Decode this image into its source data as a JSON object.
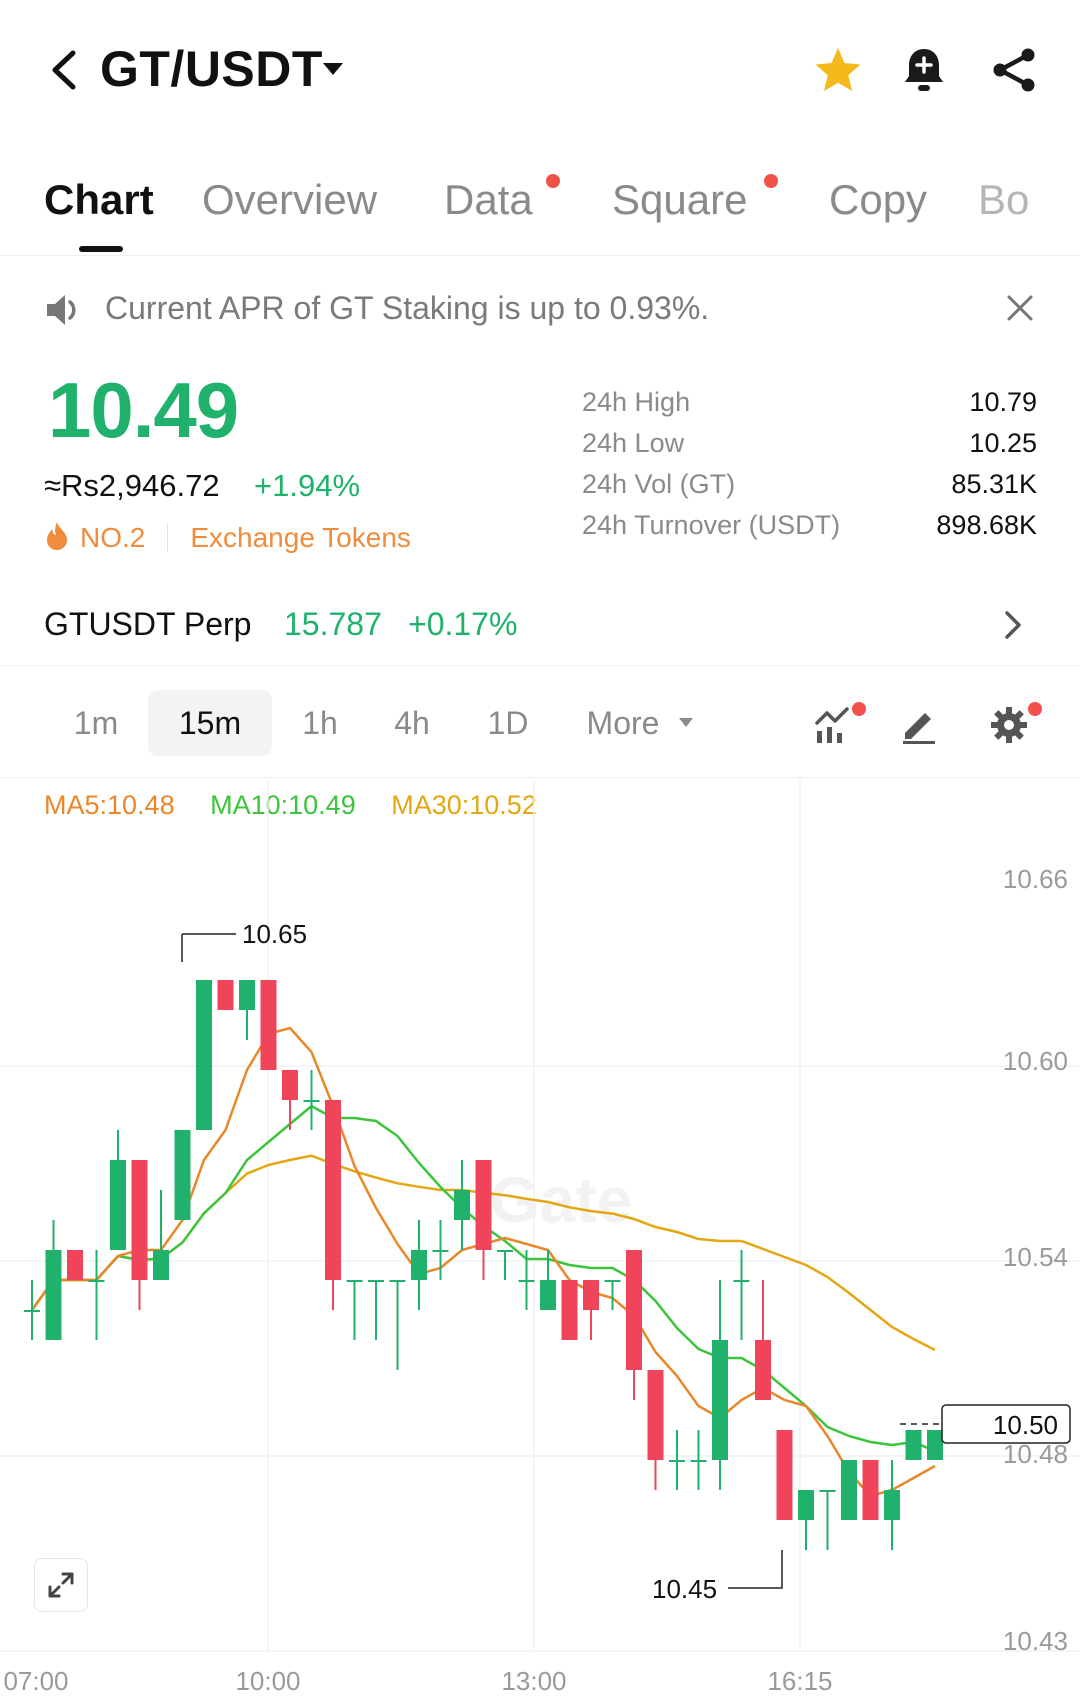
{
  "header": {
    "pair": "GT/USDT",
    "icons": [
      "back-icon",
      "caret-down-icon",
      "star-icon",
      "bell-plus-icon",
      "share-icon"
    ],
    "star_color": "#f5b91b"
  },
  "tabs": [
    {
      "label": "Chart",
      "active": true
    },
    {
      "label": "Overview",
      "active": false
    },
    {
      "label": "Data",
      "active": false,
      "dot": true
    },
    {
      "label": "Square",
      "active": false,
      "dot": true
    },
    {
      "label": "Copy",
      "active": false
    },
    {
      "label": "Bo",
      "active": false
    }
  ],
  "notice": {
    "text": "Current APR of GT Staking is up to 0.93%.",
    "icons": [
      "speaker-icon",
      "close-icon"
    ]
  },
  "price": {
    "last": "10.49",
    "fiat": "≈Rs2,946.72",
    "change": "+1.94%",
    "rank": "NO.2",
    "category": "Exchange Tokens",
    "up_color": "#20b26c",
    "down_color": "#f0445a",
    "rank_color": "#f08c3a"
  },
  "stats": [
    {
      "label": "24h High",
      "value": "10.79"
    },
    {
      "label": "24h Low",
      "value": "10.25"
    },
    {
      "label": "24h Vol (GT)",
      "value": "85.31K"
    },
    {
      "label": "24h Turnover (USDT)",
      "value": "898.68K"
    }
  ],
  "perp": {
    "name": "GTUSDT Perp",
    "price": "15.787",
    "change": "+0.17%"
  },
  "intervals": {
    "items": [
      "1m",
      "15m",
      "1h",
      "4h",
      "1D"
    ],
    "active": "15m",
    "more": "More",
    "tool_icons": [
      "indicator-icon",
      "draw-pencil-icon",
      "settings-gear-icon"
    ]
  },
  "ma_legend": [
    {
      "label": "MA5:10.48",
      "color": "#e8882a"
    },
    {
      "label": "MA10:10.49",
      "color": "#3cc43c"
    },
    {
      "label": "MA30:10.52",
      "color": "#e2a712"
    }
  ],
  "chart_data": {
    "type": "candlestick",
    "y_ticks": [
      "10.66",
      "10.60",
      "10.54",
      "10.48",
      "10.43"
    ],
    "x_ticks": [
      "07:00",
      "10:00",
      "13:00",
      "16:15"
    ],
    "y_range": [
      10.43,
      10.66
    ],
    "high_label": "10.65",
    "low_label": "10.45",
    "last_price_label": "10.50",
    "grid": true,
    "candles": [
      {
        "o": 10.535,
        "h": 10.545,
        "l": 10.525,
        "c": 10.535
      },
      {
        "o": 10.525,
        "h": 10.565,
        "l": 10.525,
        "c": 10.555
      },
      {
        "o": 10.555,
        "h": 10.555,
        "l": 10.545,
        "c": 10.545
      },
      {
        "o": 10.545,
        "h": 10.555,
        "l": 10.525,
        "c": 10.545
      },
      {
        "o": 10.555,
        "h": 10.595,
        "l": 10.555,
        "c": 10.585
      },
      {
        "o": 10.585,
        "h": 10.585,
        "l": 10.535,
        "c": 10.545
      },
      {
        "o": 10.545,
        "h": 10.575,
        "l": 10.545,
        "c": 10.555
      },
      {
        "o": 10.565,
        "h": 10.595,
        "l": 10.565,
        "c": 10.595
      },
      {
        "o": 10.595,
        "h": 10.645,
        "l": 10.595,
        "c": 10.645
      },
      {
        "o": 10.645,
        "h": 10.645,
        "l": 10.635,
        "c": 10.635
      },
      {
        "o": 10.635,
        "h": 10.645,
        "l": 10.625,
        "c": 10.645
      },
      {
        "o": 10.645,
        "h": 10.645,
        "l": 10.615,
        "c": 10.615
      },
      {
        "o": 10.615,
        "h": 10.615,
        "l": 10.595,
        "c": 10.605
      },
      {
        "o": 10.605,
        "h": 10.615,
        "l": 10.595,
        "c": 10.605
      },
      {
        "o": 10.605,
        "h": 10.605,
        "l": 10.535,
        "c": 10.545
      },
      {
        "o": 10.545,
        "h": 10.545,
        "l": 10.525,
        "c": 10.545
      },
      {
        "o": 10.545,
        "h": 10.545,
        "l": 10.525,
        "c": 10.545
      },
      {
        "o": 10.545,
        "h": 10.545,
        "l": 10.515,
        "c": 10.545
      },
      {
        "o": 10.545,
        "h": 10.565,
        "l": 10.535,
        "c": 10.555
      },
      {
        "o": 10.555,
        "h": 10.565,
        "l": 10.545,
        "c": 10.555
      },
      {
        "o": 10.565,
        "h": 10.585,
        "l": 10.555,
        "c": 10.575
      },
      {
        "o": 10.585,
        "h": 10.585,
        "l": 10.545,
        "c": 10.555
      },
      {
        "o": 10.555,
        "h": 10.555,
        "l": 10.545,
        "c": 10.555
      },
      {
        "o": 10.545,
        "h": 10.555,
        "l": 10.535,
        "c": 10.545
      },
      {
        "o": 10.535,
        "h": 10.555,
        "l": 10.535,
        "c": 10.545
      },
      {
        "o": 10.545,
        "h": 10.545,
        "l": 10.525,
        "c": 10.525
      },
      {
        "o": 10.545,
        "h": 10.545,
        "l": 10.525,
        "c": 10.535
      },
      {
        "o": 10.545,
        "h": 10.545,
        "l": 10.535,
        "c": 10.545
      },
      {
        "o": 10.555,
        "h": 10.555,
        "l": 10.505,
        "c": 10.515
      },
      {
        "o": 10.515,
        "h": 10.515,
        "l": 10.475,
        "c": 10.485
      },
      {
        "o": 10.485,
        "h": 10.495,
        "l": 10.475,
        "c": 10.485
      },
      {
        "o": 10.485,
        "h": 10.495,
        "l": 10.475,
        "c": 10.485
      },
      {
        "o": 10.485,
        "h": 10.545,
        "l": 10.475,
        "c": 10.525
      },
      {
        "o": 10.545,
        "h": 10.555,
        "l": 10.525,
        "c": 10.545
      },
      {
        "o": 10.525,
        "h": 10.545,
        "l": 10.505,
        "c": 10.505
      },
      {
        "o": 10.495,
        "h": 10.495,
        "l": 10.465,
        "c": 10.465
      },
      {
        "o": 10.465,
        "h": 10.475,
        "l": 10.455,
        "c": 10.475
      },
      {
        "o": 10.475,
        "h": 10.475,
        "l": 10.455,
        "c": 10.475
      },
      {
        "o": 10.465,
        "h": 10.485,
        "l": 10.465,
        "c": 10.485
      },
      {
        "o": 10.485,
        "h": 10.485,
        "l": 10.465,
        "c": 10.465
      },
      {
        "o": 10.465,
        "h": 10.485,
        "l": 10.455,
        "c": 10.475
      },
      {
        "o": 10.485,
        "h": 10.495,
        "l": 10.485,
        "c": 10.495
      },
      {
        "o": 10.485,
        "h": 10.495,
        "l": 10.485,
        "c": 10.495
      }
    ]
  }
}
